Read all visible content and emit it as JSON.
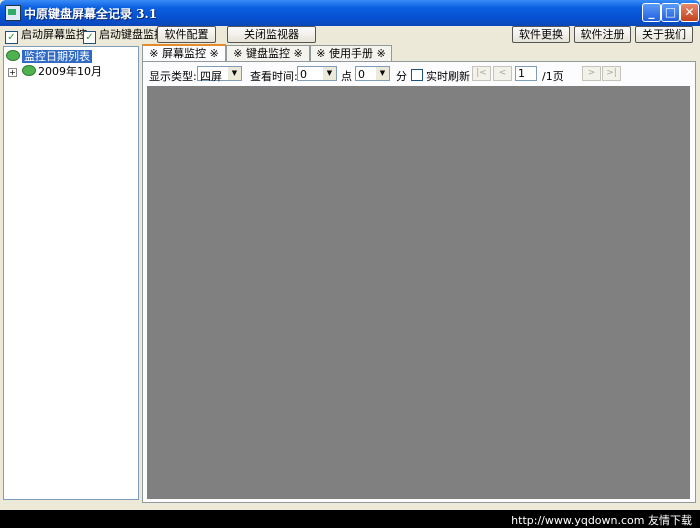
{
  "title": "中原键盘屏幕全记录 3.1",
  "window_controls": {
    "minimize": "_",
    "maximize": "□",
    "close": "✕"
  },
  "toolbar": {
    "screen_monitor_checkbox": "启动屏幕监控",
    "keyboard_monitor_checkbox": "启动键盘监控",
    "software_config_button": "软件配置",
    "close_monitor_button": "关闭监视器",
    "software_update_button": "软件更换",
    "software_register_button": "软件注册",
    "about_button": "关于我们",
    "check_mark": "✓"
  },
  "tree": {
    "root": "监控日期列表",
    "child_expander": "+",
    "child": "2009年10月"
  },
  "tabs": [
    {
      "label": "※ 屏幕监控 ※"
    },
    {
      "label": "※ 键盘监控 ※"
    },
    {
      "label": "※ 使用手册 ※"
    }
  ],
  "controls": {
    "display_type_label": "显示类型:",
    "display_type_value": "四屏",
    "view_time_label": "查看时间:",
    "hour_value": "0",
    "hour_unit": "点",
    "minute_value": "0",
    "minute_unit": "分",
    "realtime_refresh": "实时刷新",
    "page_value": "1",
    "page_total": "/1页",
    "nav_first": "|<",
    "nav_prev": "<",
    "nav_next": ">",
    "nav_last": ">|",
    "dropdown_arrow": "▼"
  },
  "watermark": "http://www.yqdown.com 友情下载"
}
